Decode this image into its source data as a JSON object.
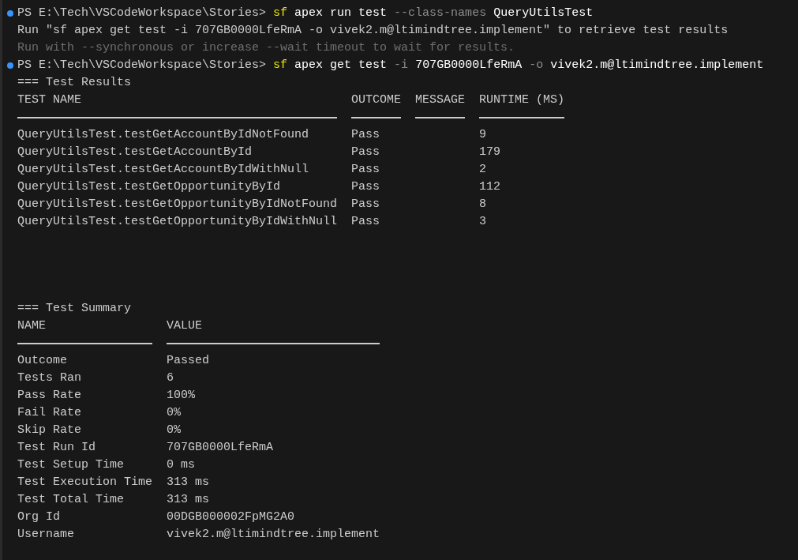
{
  "terminal": {
    "blocks": [
      {
        "kind": "prompt",
        "status_dot": true,
        "prompt": "PS E:\\Tech\\VSCodeWorkspace\\Stories>",
        "tokens": [
          {
            "kind": "command",
            "text": "sf"
          },
          {
            "kind": "arg",
            "text": "apex run test"
          },
          {
            "kind": "flag",
            "text": "--class-names"
          },
          {
            "kind": "arg",
            "text": "QueryUtilsTest"
          }
        ]
      },
      {
        "kind": "output",
        "text": "Run \"sf apex get test -i 707GB0000LfeRmA -o vivek2.m@ltimindtree.implement\" to retrieve test results"
      },
      {
        "kind": "hint",
        "text": "Run with --synchronous or increase --wait timeout to wait for results."
      },
      {
        "kind": "prompt",
        "status_dot": true,
        "prompt": "PS E:\\Tech\\VSCodeWorkspace\\Stories>",
        "tokens": [
          {
            "kind": "command",
            "text": "sf"
          },
          {
            "kind": "arg",
            "text": "apex get test"
          },
          {
            "kind": "flag",
            "text": "-i"
          },
          {
            "kind": "arg",
            "text": "707GB0000LfeRmA"
          },
          {
            "kind": "flag",
            "text": "-o"
          },
          {
            "kind": "arg",
            "text": "vivek2.m@ltimindtree.implement"
          }
        ]
      },
      {
        "kind": "table",
        "title": "=== Test Results",
        "columns": [
          "TEST NAME",
          "OUTCOME",
          "MESSAGE",
          "RUNTIME (MS)"
        ],
        "rows": [
          [
            "QueryUtilsTest.testGetAccountByIdNotFound",
            "Pass",
            "",
            "9"
          ],
          [
            "QueryUtilsTest.testGetAccountById",
            "Pass",
            "",
            "179"
          ],
          [
            "QueryUtilsTest.testGetAccountByIdWithNull",
            "Pass",
            "",
            "2"
          ],
          [
            "QueryUtilsTest.testGetOpportunityById",
            "Pass",
            "",
            "112"
          ],
          [
            "QueryUtilsTest.testGetOpportunityByIdNotFound",
            "Pass",
            "",
            "8"
          ],
          [
            "QueryUtilsTest.testGetOpportunityByIdWithNull",
            "Pass",
            "",
            "3"
          ]
        ]
      },
      {
        "kind": "table",
        "title": "=== Test Summary",
        "columns": [
          "NAME",
          "VALUE"
        ],
        "rows": [
          [
            "Outcome",
            "Passed"
          ],
          [
            "Tests Ran",
            "6"
          ],
          [
            "Pass Rate",
            "100%"
          ],
          [
            "Fail Rate",
            "0%"
          ],
          [
            "Skip Rate",
            "0%"
          ],
          [
            "Test Run Id",
            "707GB0000LfeRmA"
          ],
          [
            "Test Setup Time",
            "0 ms"
          ],
          [
            "Test Execution Time",
            "313 ms"
          ],
          [
            "Test Total Time",
            "313 ms"
          ],
          [
            "Org Id",
            "00DGB000002FpMG2A0"
          ],
          [
            "Username",
            "vivek2.m@ltimindtree.implement"
          ]
        ]
      }
    ]
  }
}
